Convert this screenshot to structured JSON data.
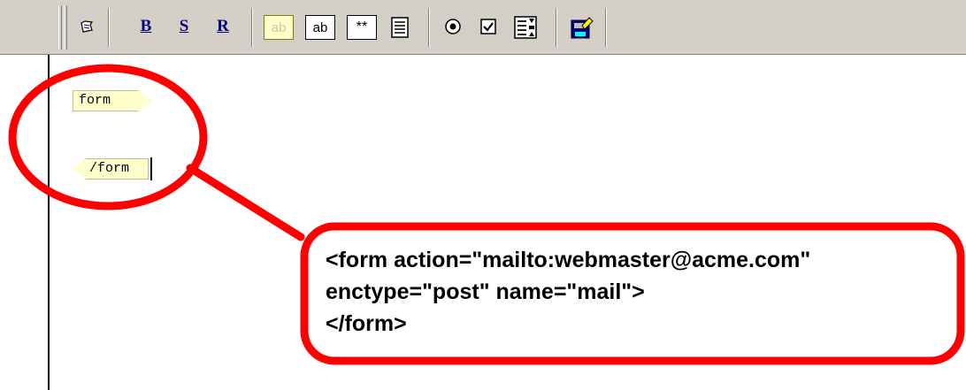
{
  "toolbar": {
    "buttons": [
      {
        "name": "document-icon",
        "kind": "icon"
      },
      {
        "name": "bold-button",
        "label": "B"
      },
      {
        "name": "strike-button",
        "label": "S"
      },
      {
        "name": "r-button",
        "label": "R"
      },
      {
        "name": "textfield-disabled-icon",
        "label": "ab"
      },
      {
        "name": "textfield-icon",
        "label": "ab"
      },
      {
        "name": "password-field-icon",
        "label": "**"
      },
      {
        "name": "textarea-icon",
        "kind": "icon"
      },
      {
        "name": "radio-button-icon",
        "kind": "icon"
      },
      {
        "name": "checkbox-icon",
        "kind": "icon"
      },
      {
        "name": "select-list-icon",
        "kind": "icon"
      },
      {
        "name": "submit-image-icon",
        "kind": "icon"
      }
    ]
  },
  "editor": {
    "open_tag": "form",
    "close_tag": "/form"
  },
  "callout": {
    "lines": [
      "<form action=\"mailto:webmaster@acme.com\"",
      "enctype=\"post\" name=\"mail\">",
      "</form>"
    ]
  },
  "colors": {
    "toolbar_bg": "#d4d0c8",
    "tag_bg": "#ffffcc",
    "annotation_red": "#ff0000",
    "icon_blue": "#000080"
  }
}
